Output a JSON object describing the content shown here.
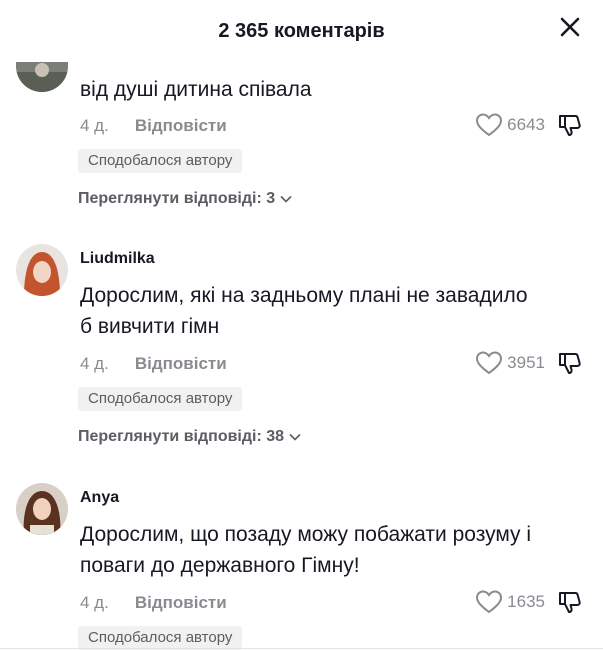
{
  "header": {
    "title": "2 365 коментарів"
  },
  "comments": [
    {
      "username": "",
      "text": "від душі дитина співала",
      "age": "4 д.",
      "reply_label": "Відповісти",
      "likes": "6643",
      "badge": "Сподобалося автору",
      "view_replies": "Переглянути відповіді: 3"
    },
    {
      "username": "Liudmilka",
      "text": "Дорослим, які на задньому плані не завадило б вивчити гімн",
      "age": "4 д.",
      "reply_label": "Відповісти",
      "likes": "3951",
      "badge": "Сподобалося автору",
      "view_replies": "Переглянути відповіді: 38"
    },
    {
      "username": "Anya",
      "text": "Дорослим, що позаду можу побажати розуму і поваги до державного Гімну!",
      "age": "4 д.",
      "reply_label": "Відповісти",
      "likes": "1635",
      "badge": "Сподобалося автору"
    }
  ],
  "colors": {
    "text": "#161823",
    "secondary": "#8a8b91",
    "badge_bg": "#f1f1f2"
  }
}
